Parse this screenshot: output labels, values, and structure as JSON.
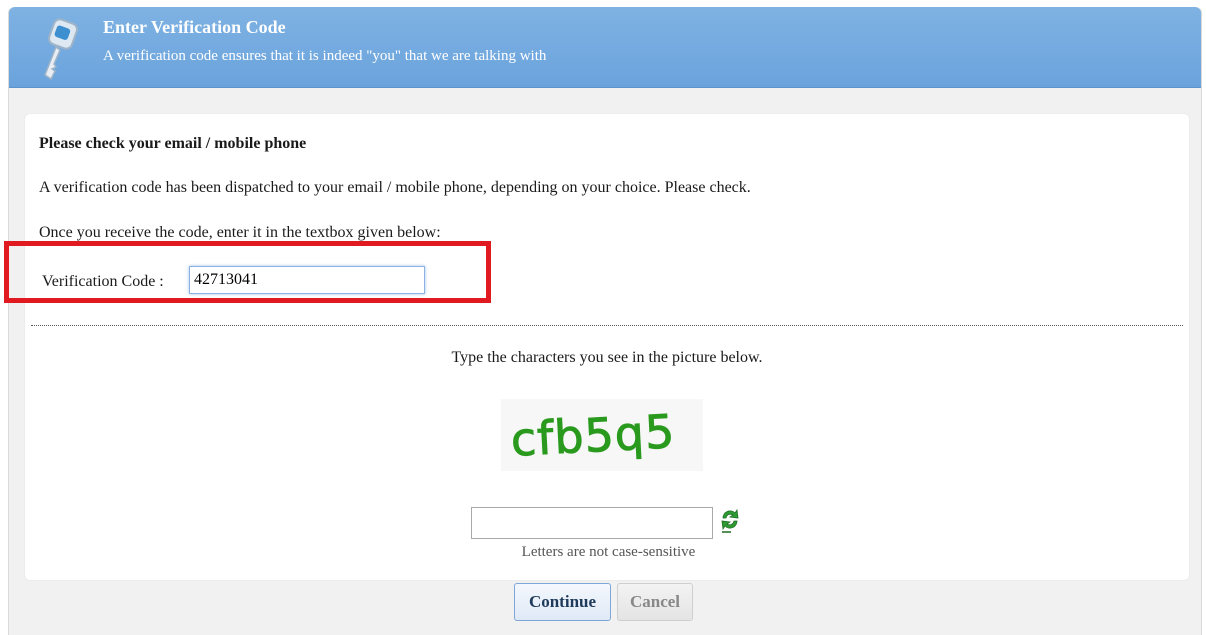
{
  "header": {
    "title": "Enter Verification Code",
    "subtitle": "A verification code ensures that it is indeed \"you\" that we are talking with",
    "icon": "key-icon"
  },
  "panel": {
    "title": "Please check your email / mobile phone",
    "line1": "A verification code has been dispatched to your email / mobile phone, depending on your choice. Please check.",
    "line2": "Once you receive the code, enter it in the textbox given below:",
    "verification_label": "Verification Code :",
    "verification_value": "42713041"
  },
  "captcha": {
    "instruction": "Type the characters you see in the picture below.",
    "image_text": "cfb5q5",
    "input_value": "",
    "note": "Letters are not case-sensitive",
    "refresh_icon": "refresh-icon"
  },
  "buttons": {
    "continue": "Continue",
    "cancel": "Cancel"
  },
  "colors": {
    "header": "#6aa3dc",
    "highlight": "#e11a22",
    "captcha_green": "#2a9a1e"
  }
}
